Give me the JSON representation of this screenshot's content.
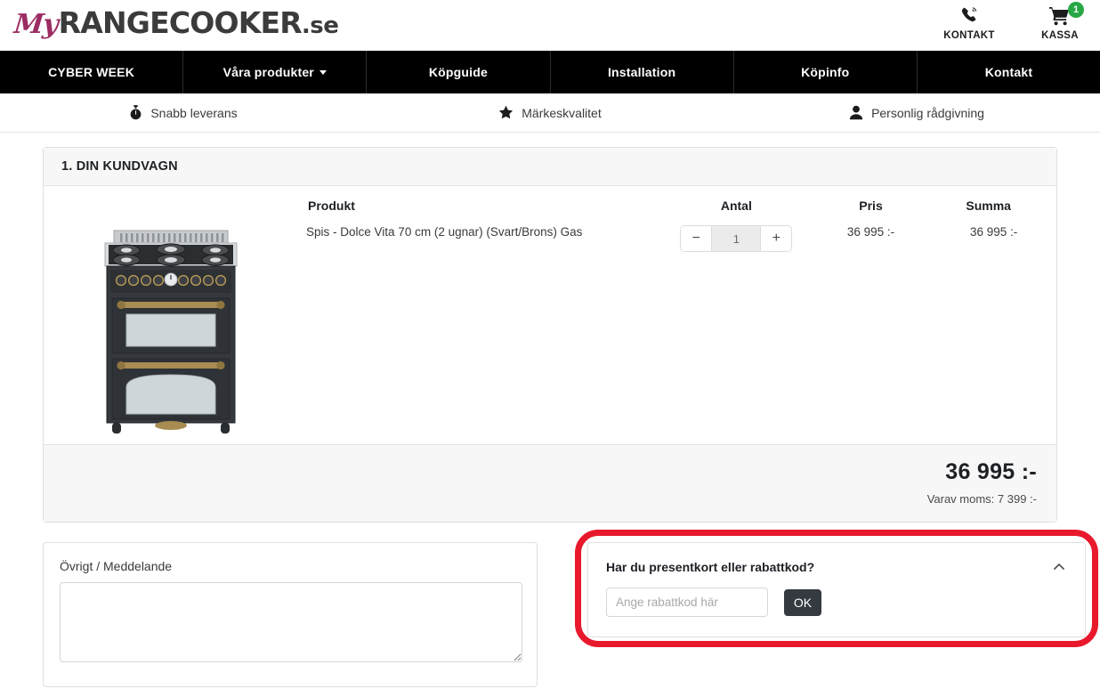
{
  "header": {
    "logo": {
      "prefix": "My",
      "main": "RANGECOOKER",
      "tld": ".se"
    },
    "actions": [
      {
        "icon": "phone-icon",
        "label": "KONTAKT"
      },
      {
        "icon": "cart-icon",
        "label": "KASSA",
        "badge": "1"
      }
    ]
  },
  "nav": {
    "items": [
      {
        "label": "CYBER WEEK",
        "has_dropdown": false
      },
      {
        "label": "Våra produkter",
        "has_dropdown": true
      },
      {
        "label": "Köpguide",
        "has_dropdown": false
      },
      {
        "label": "Installation",
        "has_dropdown": false
      },
      {
        "label": "Köpinfo",
        "has_dropdown": false
      },
      {
        "label": "Kontakt",
        "has_dropdown": false
      }
    ]
  },
  "usp": [
    {
      "icon": "stopwatch-icon",
      "label": "Snabb leverans"
    },
    {
      "icon": "star-icon",
      "label": "Märkeskvalitet"
    },
    {
      "icon": "person-icon",
      "label": "Personlig rådgivning"
    }
  ],
  "cart": {
    "title": "1. DIN KUNDVAGN",
    "columns": {
      "produkt": "Produkt",
      "antal": "Antal",
      "pris": "Pris",
      "summa": "Summa"
    },
    "items": [
      {
        "name": "Spis - Dolce Vita 70 cm (2 ugnar) (Svart/Brons) Gas",
        "quantity": "1",
        "price": "36 995 :-",
        "sum": "36 995 :-",
        "decrease_label": "−",
        "increase_label": "+",
        "image_alt": "black-range-cooker"
      }
    ],
    "summary": {
      "total": "36 995 :-",
      "vat": "Varav moms: 7 399 :-"
    }
  },
  "message": {
    "label": "Övrigt / Meddelande",
    "value": "",
    "placeholder": ""
  },
  "discount": {
    "title": "Har du presentkort eller rabattkod?",
    "input_value": "",
    "placeholder": "Ange rabattkod här",
    "ok_label": "OK",
    "collapse_icon": "chevron-up-icon",
    "highlight_color": "#e8192c"
  },
  "colors": {
    "nav_bg": "#000000",
    "accent_magenta": "#9b2d62",
    "badge_green": "#28a745",
    "button_dark": "#343a40",
    "panel_gray": "#f7f7f7"
  }
}
